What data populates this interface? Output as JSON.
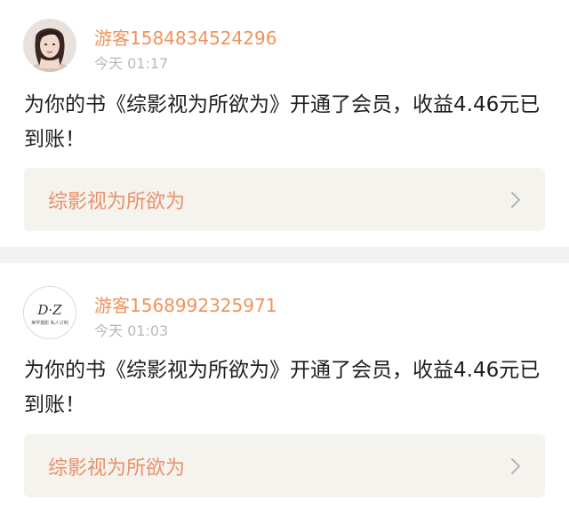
{
  "notifications": [
    {
      "username": "游客1584834524296",
      "time": "今天 01:17",
      "message": "为你的书《综影视为所欲为》开通了会员，收益4.46元已到账！",
      "book_title": "综影视为所欲为",
      "avatar": "avatar-portrait-girl",
      "chevron": "chevron-right-icon"
    },
    {
      "username": "游客1568992325971",
      "time": "今天 01:03",
      "message": "为你的书《综影视为所欲为》开通了会员，收益4.46元已到账！",
      "book_title": "综影视为所欲为",
      "avatar": "avatar-dz-logo",
      "avatar_logo_text": "D·Z",
      "avatar_logo_subtext": "美学摄影 私人订制",
      "chevron": "chevron-right-icon"
    }
  ],
  "colors": {
    "username": "#f0925a",
    "book_title": "#e8916a",
    "time": "#b8b8b8",
    "message": "#1e1e1e",
    "link_bg": "#f5f3ee",
    "separator": "#f2f2f2"
  }
}
